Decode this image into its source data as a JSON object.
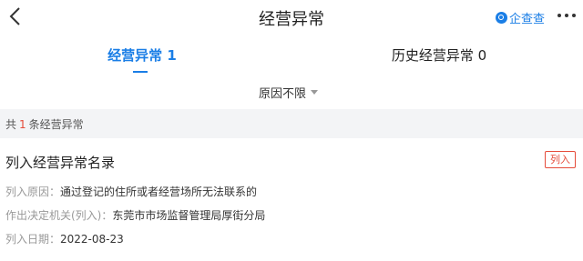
{
  "header": {
    "title": "经营异常",
    "brand_text": "企查查"
  },
  "tabs": [
    {
      "label": "经营异常 1",
      "active": true
    },
    {
      "label": "历史经营异常 0",
      "active": false
    }
  ],
  "filter": {
    "label": "原因不限"
  },
  "summary": {
    "prefix": "共",
    "count": "1",
    "suffix": "条经营异常"
  },
  "record": {
    "title": "列入经营异常名录",
    "status": "列入",
    "fields": [
      {
        "label": "列入原因：",
        "value": "通过登记的住所或者经营场所无法联系的"
      },
      {
        "label": "作出决定机关(列入)：",
        "value": "东莞市市场监督管理局厚街分局"
      },
      {
        "label": "列入日期：",
        "value": "2022-08-23"
      }
    ]
  },
  "colors": {
    "accent": "#1a7ee6",
    "warning": "#e54b3a",
    "summary_bg": "#f3f4f6"
  },
  "icons": {
    "back": "chevron-left-icon",
    "brand": "qichacha-logo-icon",
    "more": "more-dots-icon",
    "filter": "caret-down-icon"
  }
}
